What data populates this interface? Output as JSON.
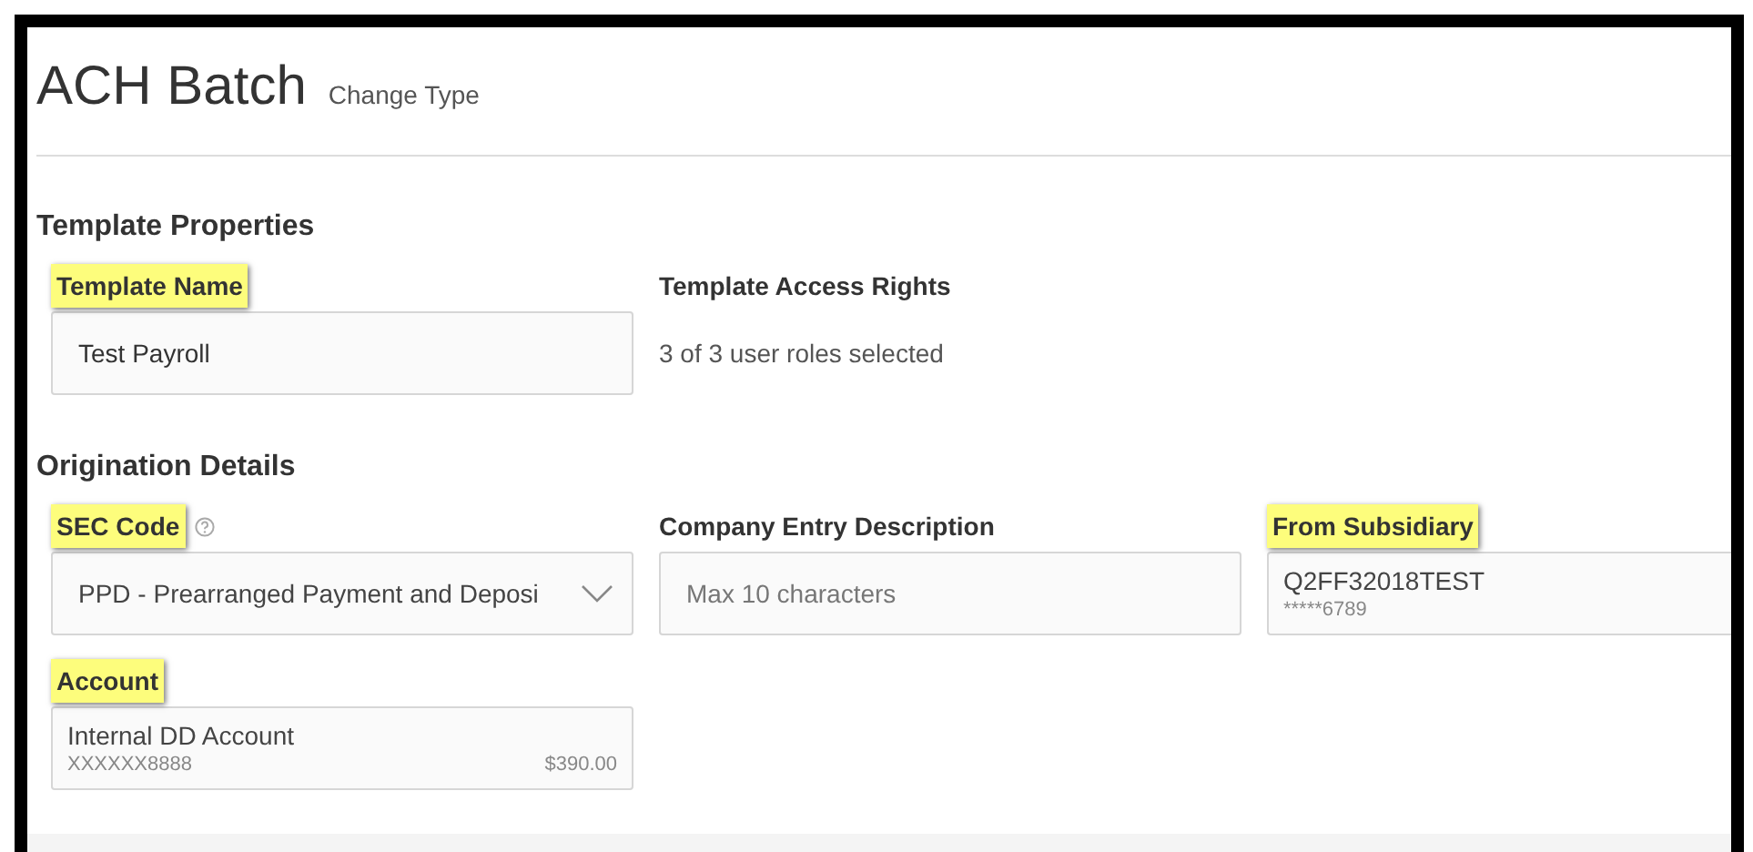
{
  "header": {
    "title": "ACH Batch",
    "action": "Change Type"
  },
  "sections": [
    {
      "title": "Template Properties",
      "fields": [
        {
          "label": "Template Name",
          "highlighted": true,
          "kind": "input",
          "value": "Test Payroll"
        },
        {
          "label": "Template Access Rights",
          "highlighted": false,
          "kind": "static",
          "value": "3 of 3 user roles selected"
        }
      ]
    },
    {
      "title": "Origination Details",
      "fields": [
        {
          "label": "SEC Code",
          "highlighted": true,
          "help": true,
          "kind": "select",
          "value": "PPD - Prearranged Payment and Deposi"
        },
        {
          "label": "Company Entry Description",
          "highlighted": false,
          "kind": "input",
          "placeholder": "Max 10 characters"
        },
        {
          "label": "From Subsidiary",
          "highlighted": true,
          "kind": "account",
          "value": "Q2FF32018TEST",
          "detail": "*****6789"
        },
        {
          "label": "Account",
          "highlighted": true,
          "kind": "account",
          "value": "Internal DD Account",
          "detail": "XXXXXX8888",
          "amount": "$390.00"
        }
      ]
    }
  ]
}
